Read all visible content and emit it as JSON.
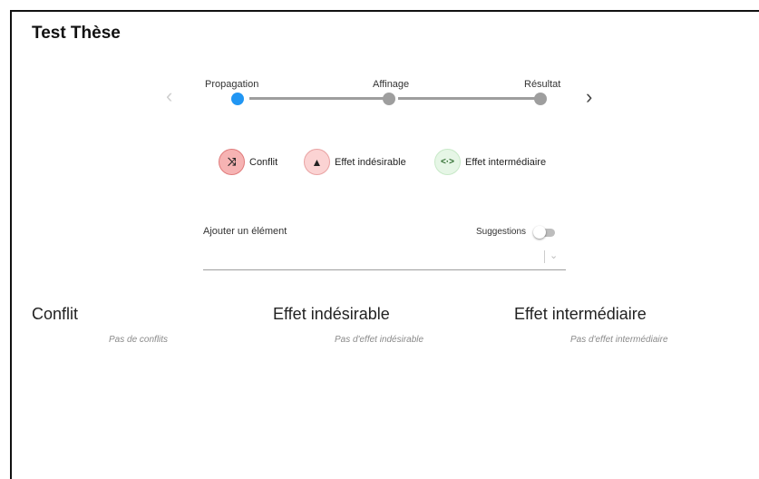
{
  "app": {
    "title": "Test Thèse"
  },
  "stepper": {
    "prev_icon": "chevron-left-icon",
    "next_icon": "chevron-right-icon",
    "prev_glyph": "‹",
    "next_glyph": "›",
    "steps": [
      {
        "label": "Propagation",
        "active": true
      },
      {
        "label": "Affinage",
        "active": false
      },
      {
        "label": "Résultat",
        "active": false
      }
    ],
    "active_color": "#2196f3",
    "inactive_color": "#9e9e9e"
  },
  "legend": [
    {
      "label": "Conflit",
      "icon": "shuffle-icon",
      "glyph": "⤨",
      "bg": "#f6b3b3"
    },
    {
      "label": "Effet indésirable",
      "icon": "warning-icon",
      "glyph": "▲",
      "bg": "#fbd3d3"
    },
    {
      "label": "Effet intermédiaire",
      "icon": "arrows-horizontal-icon",
      "glyph": "<·>",
      "bg": "#e6f6e6"
    }
  ],
  "add_element": {
    "label": "Ajouter un élément",
    "suggestions_label": "Suggestions",
    "suggestions_on": false,
    "dropdown_icon": "chevron-down-icon",
    "dropdown_glyph": "⌄"
  },
  "columns": [
    {
      "title": "Conflit",
      "empty_text": "Pas de conflits"
    },
    {
      "title": "Effet indésirable",
      "empty_text": "Pas d'effet indésirable"
    },
    {
      "title": "Effet intermédiaire",
      "empty_text": "Pas d'effet intermédiaire"
    }
  ]
}
